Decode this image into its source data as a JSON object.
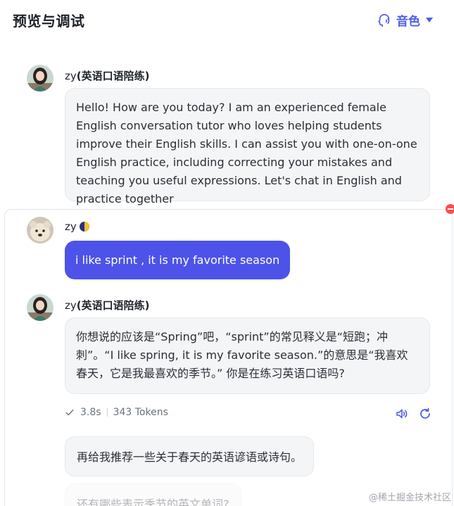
{
  "header": {
    "title": "预览与调试",
    "voice_label": "音色"
  },
  "messages": [
    {
      "role": "assistant",
      "name_prefix": "zy",
      "name_bold": "(英语口语陪练)",
      "text": "Hello! How are you today? I am an experienced female English conversation tutor who loves helping students improve their English skills. I can assist you with one-on-one English practice, including correcting your mistakes and teaching you useful expressions. Let's chat in English and practice together"
    },
    {
      "role": "user",
      "name": "zy",
      "text": "i like sprint , it is my favorite season"
    },
    {
      "role": "assistant",
      "name_prefix": "zy",
      "name_bold": "(英语口语陪练)",
      "text": "你想说的应该是“Spring”吧，“sprint”的常见释义是“短跑；冲刺”。“I like spring, it is my favorite season.”的意思是“我喜欢春天，它是我最喜欢的季节。” 你是在练习英语口语吗?"
    }
  ],
  "meta": {
    "duration": "3.8s",
    "tokens": "343 Tokens"
  },
  "suggestions": [
    "再给我推荐一些关于春天的英语谚语或诗句。",
    "还有哪些表示季节的英文单词?"
  ],
  "watermark": "@稀土掘金技术社区",
  "colors": {
    "accent": "#4e5ee4",
    "user_bubble": "#4d53e8",
    "ai_bubble": "#f4f5f7"
  }
}
